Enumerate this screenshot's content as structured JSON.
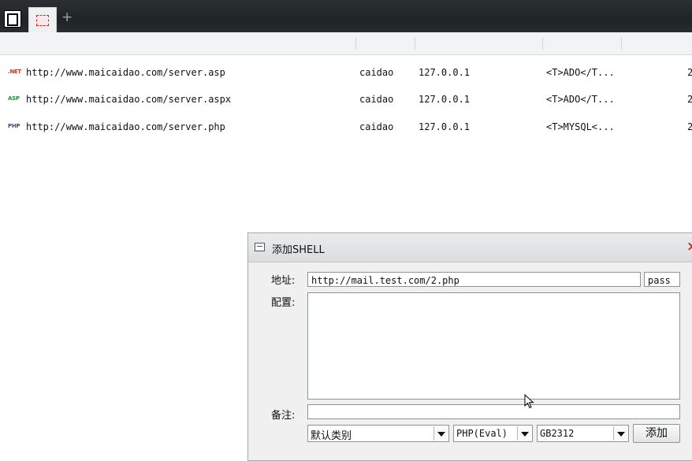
{
  "list": {
    "rows": [
      {
        "type_label": ".NET",
        "type_color": "#c0392b",
        "url": "http://www.maicaidao.com/server.asp",
        "password": "caidao",
        "ip": "127.0.0.1",
        "config": "<T>ADO</T...",
        "extra": "2"
      },
      {
        "type_label": "ASP",
        "type_color": "#2e8b3e",
        "url": "http://www.maicaidao.com/server.aspx",
        "password": "caidao",
        "ip": "127.0.0.1",
        "config": "<T>ADO</T...",
        "extra": "2"
      },
      {
        "type_label": "PHP",
        "type_color": "#3c4a8a",
        "url": "http://www.maicaidao.com/server.php",
        "password": "caidao",
        "ip": "127.0.0.1",
        "config": "<T>MYSQL<...",
        "extra": "2"
      }
    ]
  },
  "dialog": {
    "title": "添加SHELL",
    "close": "×",
    "address_label": "地址:",
    "address_value": "http://mail.test.com/2.php",
    "password_value": "pass",
    "config_label": "配置:",
    "config_value": "",
    "note_label": "备注:",
    "note_value": "",
    "category_selected": "默认类别",
    "script_type_selected": "PHP(Eval)",
    "encoding_selected": "GB2312",
    "add_button": "添加"
  },
  "tabbar": {
    "plus": "+"
  }
}
